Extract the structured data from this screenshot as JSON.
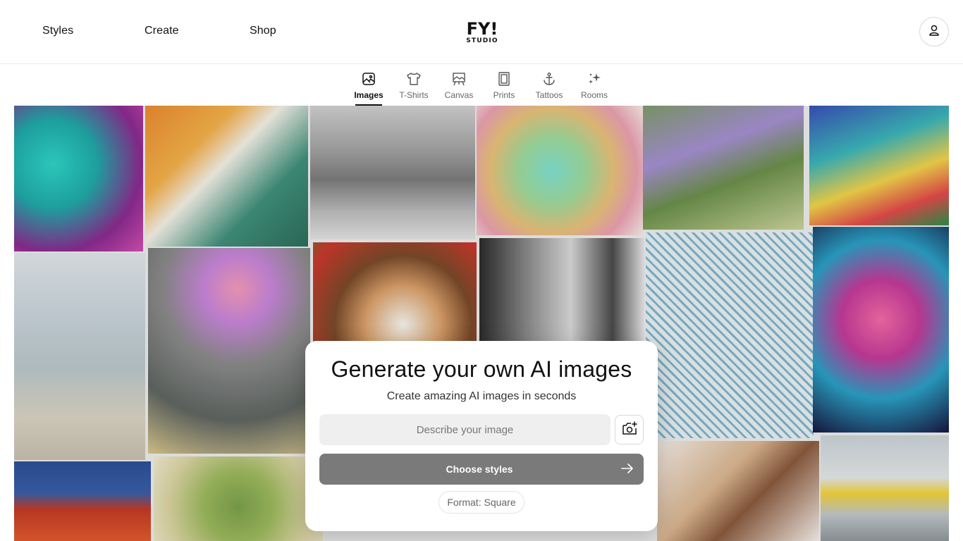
{
  "nav": {
    "styles": "Styles",
    "create": "Create",
    "shop": "Shop",
    "logo_text_top": "FY!",
    "logo_text_bottom": "STUDIO"
  },
  "tabs": [
    {
      "label": "Images",
      "icon": "image-icon",
      "active": true
    },
    {
      "label": "T-Shirts",
      "icon": "tshirt-icon",
      "active": false
    },
    {
      "label": "Canvas",
      "icon": "canvas-easel-icon",
      "active": false
    },
    {
      "label": "Prints",
      "icon": "frame-print-icon",
      "active": false
    },
    {
      "label": "Tattoos",
      "icon": "anchor-icon",
      "active": false
    },
    {
      "label": "Rooms",
      "icon": "sparkle-icon",
      "active": false
    }
  ],
  "hero": {
    "title": "Generate your own AI images",
    "subtitle": "Create amazing AI images in seconds",
    "prompt_placeholder": "Describe your image",
    "prompt_value": "",
    "upload_icon": "camera-plus-icon",
    "choose_label": "Choose styles",
    "format_label": "Format: Square"
  },
  "colors": {
    "primary_button": "#7a7a7a",
    "input_bg": "#efefef",
    "text": "#111111"
  }
}
